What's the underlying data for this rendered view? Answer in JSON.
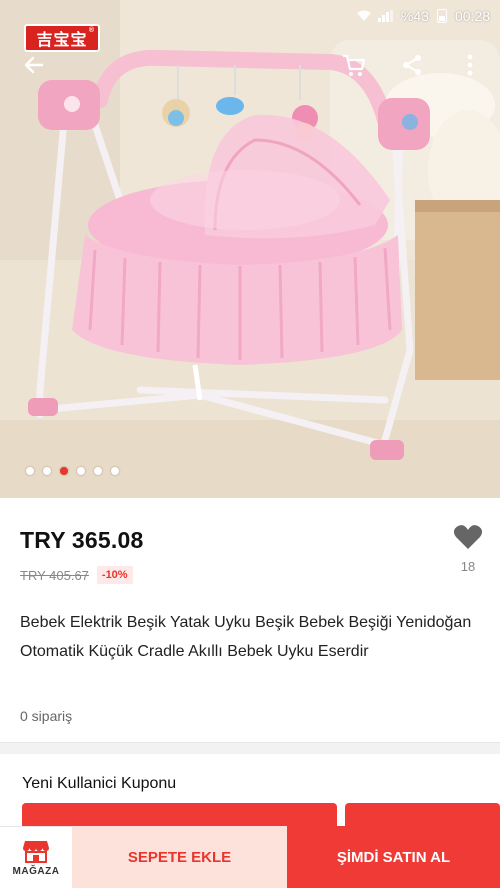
{
  "status_bar": {
    "battery": "%43",
    "time": "00:28"
  },
  "brand": {
    "logo_text": "吉宝宝"
  },
  "header": {
    "back_icon": "arrow-left-icon",
    "cart_icon": "cart-icon",
    "share_icon": "share-icon",
    "more_icon": "more-vertical-icon"
  },
  "gallery": {
    "image_count": 6,
    "active_index": 2,
    "accent": "#e8352e"
  },
  "product": {
    "price": "TRY 365.08",
    "old_price": "TRY 405.67",
    "discount": "-10%",
    "favorite_count": "18",
    "title": "Bebek Elektrik Beşik Yatak Uyku Beşik Bebek Beşiği Yenidoğan Otomatik Küçük Cradle Akıllı Bebek Uyku Eserdir",
    "orders": "0 sipariş"
  },
  "coupon": {
    "title": "Yeni Kullanici Kuponu"
  },
  "bottom_bar": {
    "store_label": "MAĞAZA",
    "add_to_cart": "SEPETE EKLE",
    "buy_now": "ŞİMDİ SATIN AL"
  },
  "colors": {
    "brand_red": "#ef3a35",
    "add_cart_bg": "#fde2dc",
    "product_pink": "#f3a6c4"
  }
}
